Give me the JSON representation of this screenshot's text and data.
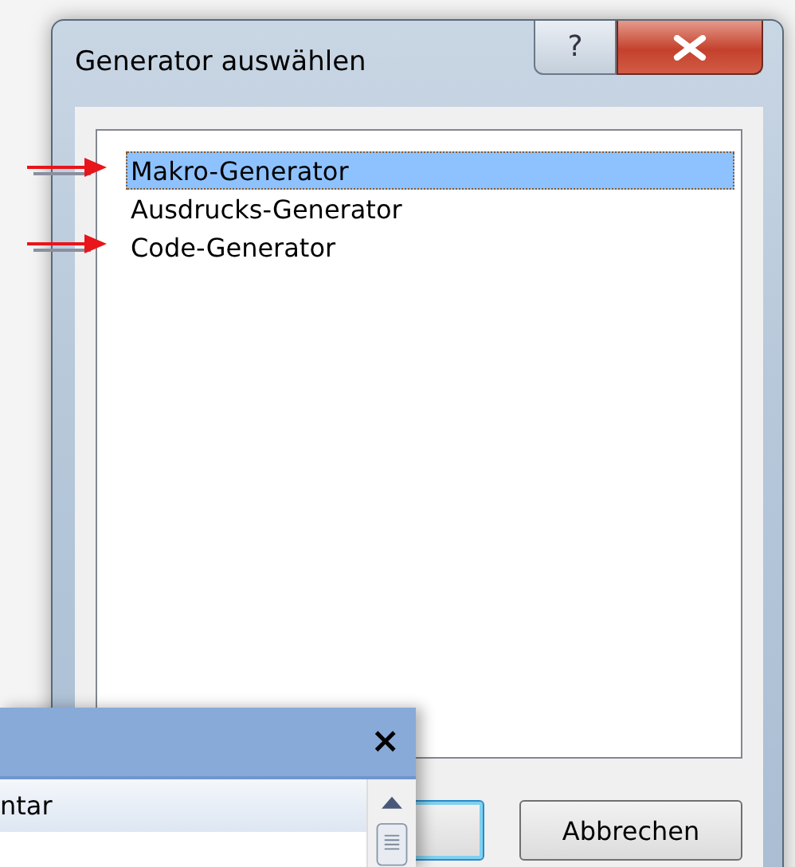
{
  "window": {
    "title": "Generator auswählen",
    "help_button": "?"
  },
  "list": {
    "items": [
      {
        "label": "Makro-Generator",
        "selected": true,
        "marked": true
      },
      {
        "label": "Ausdrucks-Generator",
        "selected": false,
        "marked": false
      },
      {
        "label": "Code-Generator",
        "selected": false,
        "marked": true
      }
    ]
  },
  "buttons": [
    {
      "kind": "default"
    },
    {
      "label": "Abbrechen",
      "kind": "normal"
    }
  ],
  "overlay_panel": {
    "close": "×",
    "row_text": "ntar"
  }
}
